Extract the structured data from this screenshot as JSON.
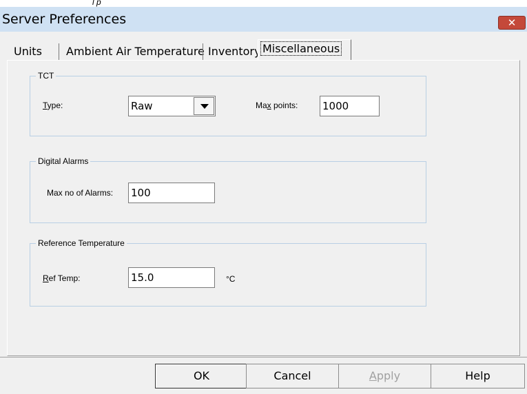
{
  "window": {
    "title": "Server Preferences",
    "top_fragment": "l p",
    "close_symbol": "✕"
  },
  "tabs": [
    {
      "label": "Units"
    },
    {
      "label": "Ambient Air Temperature"
    },
    {
      "label": "Inventory"
    },
    {
      "label": "Miscellaneous",
      "active": true
    }
  ],
  "tct": {
    "legend": "TCT",
    "type_label_mnemonic": "T",
    "type_label_rest": "ype:",
    "type_value": "Raw",
    "max_points_label_pre": "Ma",
    "max_points_label_mnemonic": "x",
    "max_points_label_post": " points:",
    "max_points_value": "1000"
  },
  "digital_alarms": {
    "legend": "Digital Alarms",
    "max_alarms_label": "Max no of Alarms:",
    "max_alarms_value": "100"
  },
  "reference_temperature": {
    "legend": "Reference Temperature",
    "ref_temp_label_mnemonic": "R",
    "ref_temp_label_rest": "ef Temp:",
    "ref_temp_value": "15.0",
    "unit": "°C"
  },
  "buttons": {
    "ok": "OK",
    "cancel": "Cancel",
    "apply_mnemonic": "A",
    "apply_rest": "pply",
    "help": "Help"
  }
}
